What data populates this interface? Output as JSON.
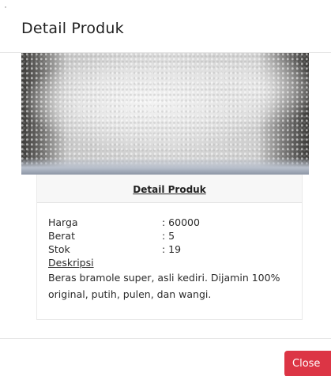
{
  "modal": {
    "title": "Detail Produk",
    "card_title": "Detail Produk",
    "fields": [
      {
        "label": "Harga",
        "value": ": 60000"
      },
      {
        "label": "Berat",
        "value": ": 5"
      },
      {
        "label": "Stok",
        "value": ": 19"
      }
    ],
    "description_label": "Deskripsi",
    "description": "Beras bramole super, asli kediri. Dijamin 100% original, putih, pulen, dan wangi.",
    "close_label": "Close"
  },
  "colors": {
    "close_button": "#dc3545",
    "card_header_bg": "#f7f7f7"
  }
}
